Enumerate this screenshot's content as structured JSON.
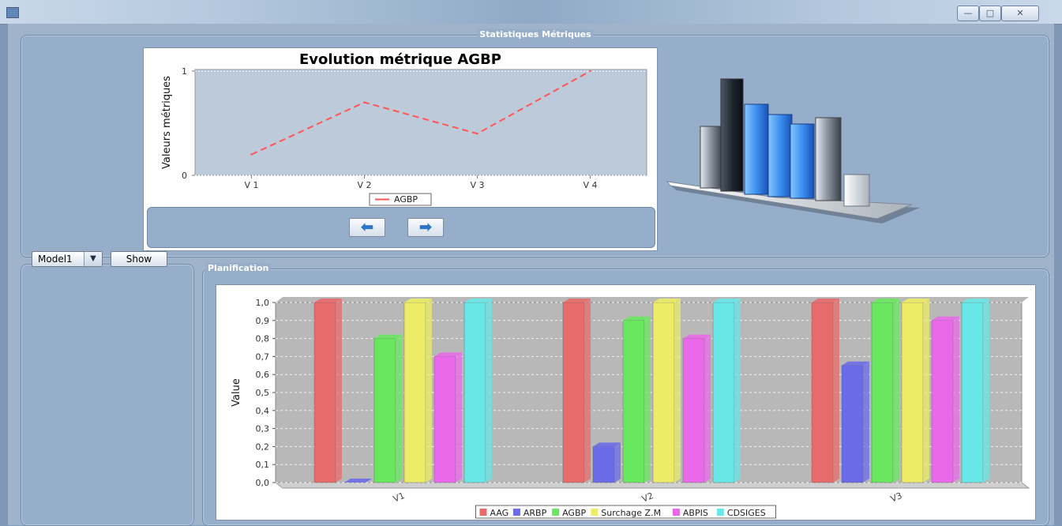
{
  "window": {
    "minimize_glyph": "—",
    "maximize_glyph": "□",
    "close_glyph": "✕"
  },
  "stats_panel": {
    "title": "Statistiques Métriques"
  },
  "line_chart": {
    "title": "Evolution métrique AGBP",
    "nav_prev_glyph": "⬅",
    "nav_next_glyph": "➡"
  },
  "controls": {
    "model_value": "Model1",
    "dropdown_glyph": "▼",
    "show_label": "Show"
  },
  "planning_panel": {
    "title": "Planification"
  },
  "chart_data": [
    {
      "type": "line",
      "title": "Evolution métrique AGBP",
      "xlabel": "",
      "ylabel": "Valeurs métriques",
      "categories": [
        "V 1",
        "V 2",
        "V 3",
        "V 4"
      ],
      "yticks": [
        "0",
        "1"
      ],
      "ylim": [
        0,
        1
      ],
      "series": [
        {
          "name": "AGBP",
          "values": [
            0.2,
            0.7,
            0.4,
            1.0
          ],
          "color": "#ff5555"
        }
      ],
      "legend": "bottom",
      "grid": true
    },
    {
      "type": "bar",
      "title": "",
      "xlabel": "",
      "ylabel": "Value",
      "categories": [
        "V1",
        "V2",
        "V3"
      ],
      "yticks": [
        "0,0",
        "0,1",
        "0,2",
        "0,3",
        "0,4",
        "0,5",
        "0,6",
        "0,7",
        "0,8",
        "0,9",
        "1,0"
      ],
      "ylim": [
        0,
        1
      ],
      "series": [
        {
          "name": "AAG",
          "values": [
            1.0,
            1.0,
            1.0
          ],
          "color": "#e86b6b"
        },
        {
          "name": "ARBP",
          "values": [
            0.0,
            0.2,
            0.65
          ],
          "color": "#6b6be8"
        },
        {
          "name": "AGBP",
          "values": [
            0.8,
            0.9,
            1.0
          ],
          "color": "#69e85f"
        },
        {
          "name": "Surchage Z.M",
          "values": [
            1.0,
            1.0,
            1.0
          ],
          "color": "#ecec67"
        },
        {
          "name": "ABPIS",
          "values": [
            0.7,
            0.8,
            0.9
          ],
          "color": "#ea69ea"
        },
        {
          "name": "CDSIGES",
          "values": [
            1.0,
            1.0,
            1.0
          ],
          "color": "#69e6e6"
        }
      ],
      "legend": "bottom",
      "grid": true
    }
  ]
}
